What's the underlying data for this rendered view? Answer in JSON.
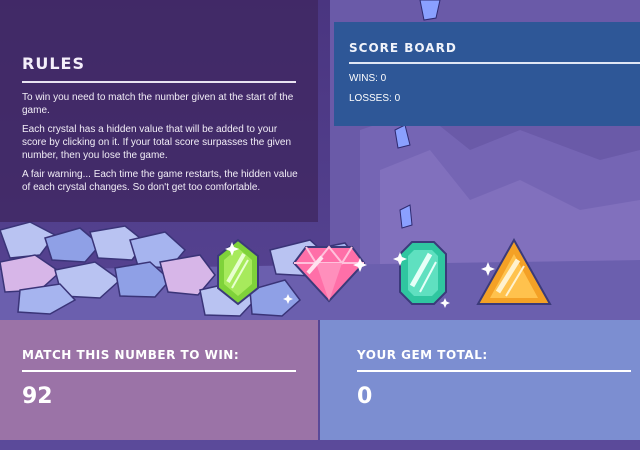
{
  "rules": {
    "title": "RULES",
    "paragraphs": [
      "To win you need to match the number given at the start of the game.",
      "Each crystal has a hidden value that will be added to your score by clicking on it. If your total score surpasses the given number, then you lose the game.",
      "A fair warning... Each time the game restarts, the hidden value of each crystal changes. So don't get too comfortable."
    ]
  },
  "scoreboard": {
    "title": "SCORE BOARD",
    "wins_text": "WINS: 0",
    "losses_text": "LOSSES: 0"
  },
  "crystals": [
    {
      "icon": "green-crystal-icon",
      "color": "#7fd23a"
    },
    {
      "icon": "pink-crystal-icon",
      "color": "#ff6fa8"
    },
    {
      "icon": "teal-crystal-icon",
      "color": "#2fc6a0"
    },
    {
      "icon": "orange-crystal-icon",
      "color": "#f4a126"
    }
  ],
  "target": {
    "label": "MATCH THIS NUMBER TO WIN:",
    "value": "92"
  },
  "total": {
    "label": "YOUR GEM TOTAL:",
    "value": "0"
  },
  "colors": {
    "rules_panel": "#3f2660",
    "scoreboard_panel": "#2e5797",
    "target_panel": "#9b73a7",
    "total_panel": "#7c8ed1"
  }
}
